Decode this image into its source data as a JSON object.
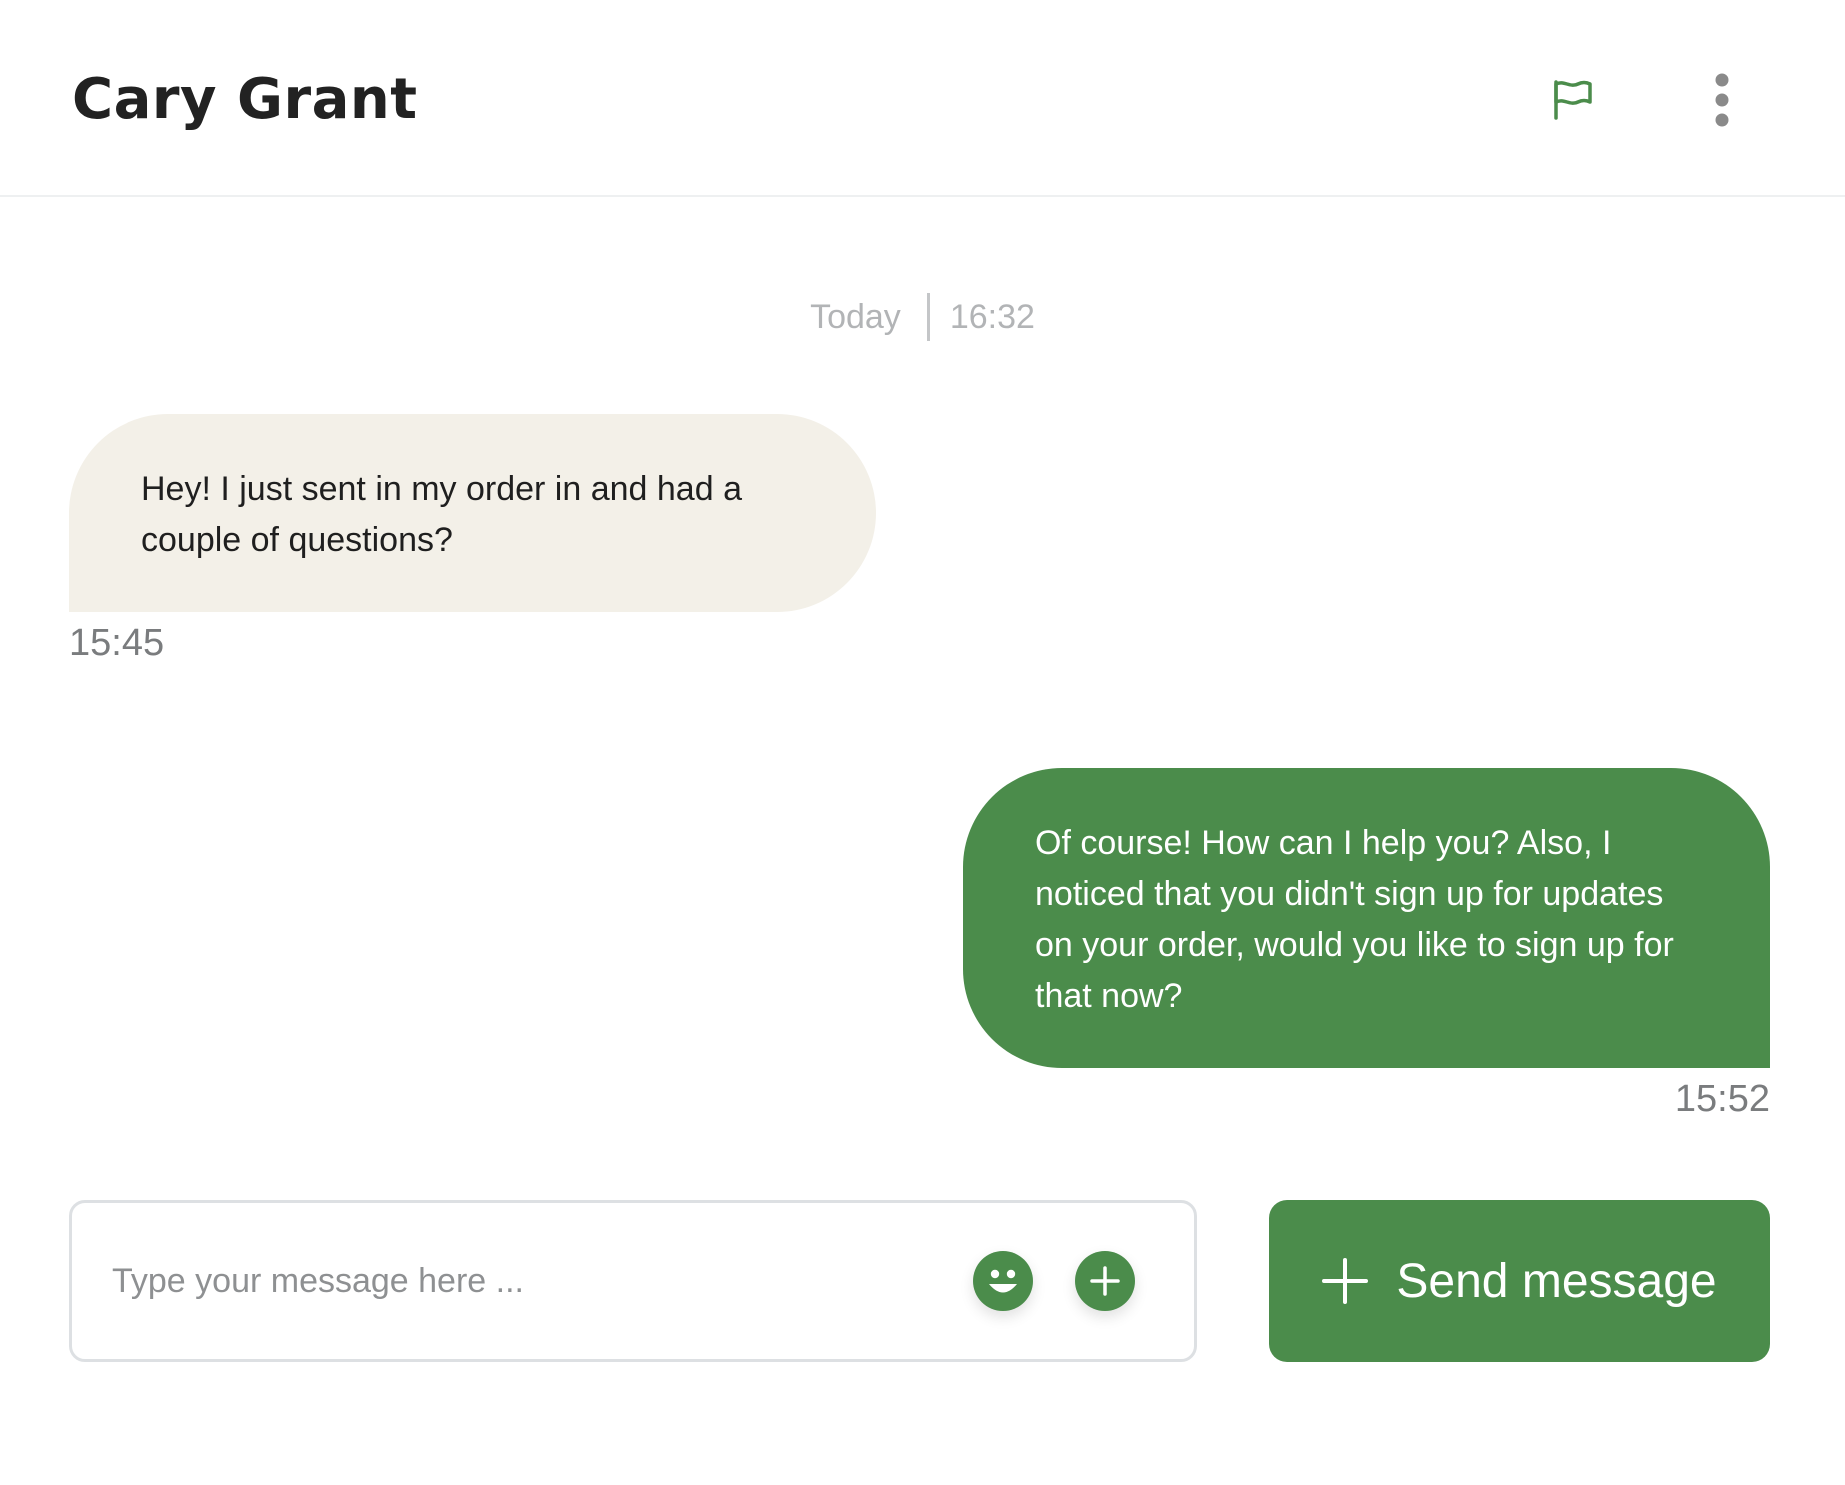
{
  "header": {
    "contact_name": "Cary Grant",
    "flag_icon": "flag-icon",
    "more_icon": "more-vertical-icon"
  },
  "date_separator": {
    "day": "Today",
    "time": "16:32"
  },
  "messages": [
    {
      "direction": "incoming",
      "text": "Hey! I just sent in my order in and had a couple of questions?",
      "time": "15:45"
    },
    {
      "direction": "outgoing",
      "text": "Of course! How can I help you? Also, I noticed that you didn't sign up for updates on your order, would you like to sign up for that now?",
      "time": "15:52"
    }
  ],
  "composer": {
    "placeholder": "Type your message here ...",
    "emoji_icon": "smiley-icon",
    "attach_icon": "plus-icon"
  },
  "send_button": {
    "label": "Send message",
    "icon": "plus-icon"
  },
  "colors": {
    "accent": "#4b8c4b",
    "incoming_bubble": "#f3f0e8",
    "muted_text": "#b2b4b6"
  }
}
